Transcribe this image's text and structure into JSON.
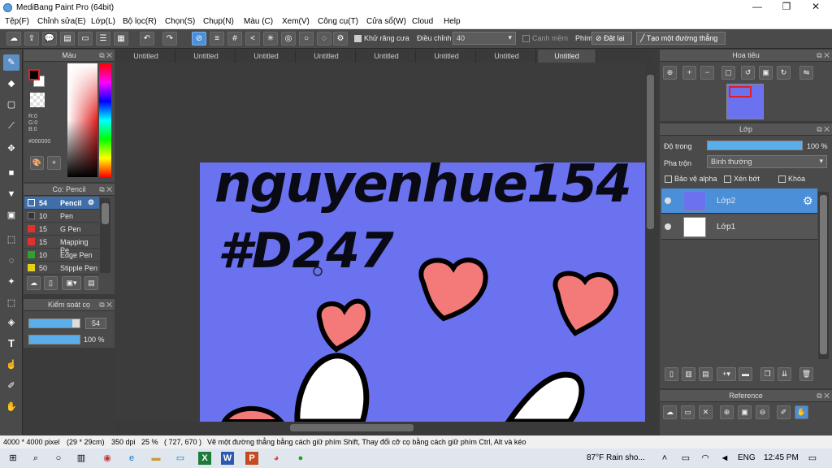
{
  "window": {
    "title": "MediBang Paint Pro (64bit)",
    "minimize": "—",
    "maximize": "❐",
    "close": "✕"
  },
  "menu": [
    "Tệp(F)",
    "Chỉnh sửa(E)",
    "Lớp(L)",
    "Bộ lọc(R)",
    "Chọn(S)",
    "Chụp(N)",
    "Màu (C)",
    "Xem(V)",
    "Công cụ(T)",
    "Cửa sổ(W)",
    "Cloud",
    "Help"
  ],
  "toolbar": {
    "antialias_label": "Khử răng cưa",
    "correction_label": "Điều chỉnh",
    "correction_value": "40",
    "edge_label": "Cạnh mềm",
    "key_label": "Phím",
    "reset_label": "Đặt lại",
    "straight_line_label": "Tạo một đường thẳng"
  },
  "color_panel": {
    "title": "Màu",
    "r": "R:0",
    "g": "G:0",
    "b": "B:0",
    "hex": "#000000",
    "primary": "#000000",
    "accent": "#e02020"
  },
  "brush_panel": {
    "title": "Cọ: Pencil",
    "brushes": [
      {
        "size": "54",
        "name": "Pencil",
        "color": "#3a5fa0"
      },
      {
        "size": "10",
        "name": "Pen",
        "color": "#333333"
      },
      {
        "size": "15",
        "name": "G Pen",
        "color": "#e03030"
      },
      {
        "size": "15",
        "name": "Mapping Pe",
        "color": "#e03030"
      },
      {
        "size": "10",
        "name": "Edge Pen",
        "color": "#30a030"
      },
      {
        "size": "50",
        "name": "Stipple Pen",
        "color": "#e0d020"
      }
    ]
  },
  "brush_control": {
    "title": "Kiểm soát cọ",
    "size_value": "54",
    "opacity_value": "100 %",
    "size_fraction": 0.85,
    "opacity_fraction": 1.0
  },
  "tabs": [
    "Untitled",
    "Untitled",
    "Untitled",
    "Untitled",
    "Untitled",
    "Untitled",
    "Untitled",
    "Untitled"
  ],
  "canvas": {
    "background": "#6b72f0",
    "text_line1": "nguyenhue154",
    "text_line2": "#D247"
  },
  "navigator": {
    "title": "Hoa tiêu"
  },
  "layer_panel": {
    "title": "Lớp",
    "opacity_label": "Độ trong",
    "opacity_value": "100 %",
    "blend_label": "Pha trộn",
    "blend_value": "Bình thường",
    "protect_alpha": "Bảo vệ alpha",
    "clipping": "Xén bớt",
    "lock": "Khóa",
    "layers": [
      {
        "name": "Lớp2",
        "selected": true
      },
      {
        "name": "Lớp1",
        "selected": false
      }
    ]
  },
  "reference_panel": {
    "title": "Reference"
  },
  "status": {
    "size": "4000 * 4000 pixel",
    "cm": "(29 * 29cm)",
    "dpi": "350 dpi",
    "zoom": "25 %",
    "coords": "( 727, 670 )",
    "hint": "Vẽ một đường thẳng bằng cách giữ phím Shift, Thay đổi cỡ cọ bằng cách giữ phím Ctrl, Alt và kéo"
  },
  "taskbar": {
    "weather": "87°F  Rain sho...",
    "lang": "ENG",
    "time": "12:45 PM"
  }
}
